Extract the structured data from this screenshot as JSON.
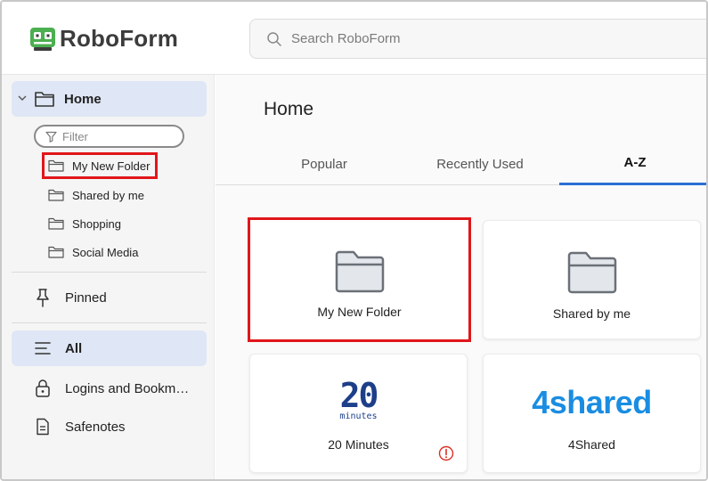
{
  "app": {
    "name": "RoboForm"
  },
  "search": {
    "placeholder": "Search RoboForm"
  },
  "sidebar": {
    "home_label": "Home",
    "filter_placeholder": "Filter",
    "folders": [
      {
        "label": "My New Folder"
      },
      {
        "label": "Shared by me"
      },
      {
        "label": "Shopping"
      },
      {
        "label": "Social Media"
      }
    ],
    "nav": [
      {
        "label": "Pinned",
        "icon": "pin-icon"
      },
      {
        "label": "All",
        "icon": "list-icon"
      },
      {
        "label": "Logins and Bookm…",
        "icon": "lock-icon"
      },
      {
        "label": "Safenotes",
        "icon": "note-icon"
      }
    ]
  },
  "main": {
    "title": "Home",
    "tabs": [
      {
        "label": "Popular"
      },
      {
        "label": "Recently Used"
      },
      {
        "label": "A-Z"
      }
    ],
    "cards": [
      {
        "label": "My New Folder",
        "icon": "folder-icon"
      },
      {
        "label": "Shared by me",
        "icon": "folder-icon"
      },
      {
        "label": "20 Minutes",
        "logo_main": "20",
        "logo_sub": "minutes"
      },
      {
        "label": "4Shared",
        "logo_main": "4shared"
      }
    ]
  },
  "colors": {
    "accent": "#2b6fd3",
    "highlight": "#e0161b",
    "active_bg": "#dfe6f5",
    "logo_green": "#4caf50",
    "warning": "#d93025"
  }
}
